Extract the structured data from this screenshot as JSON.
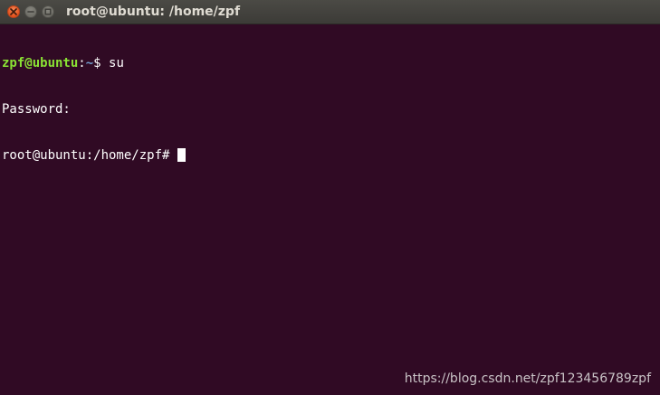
{
  "window": {
    "title": "root@ubuntu: /home/zpf",
    "buttons": {
      "close": "close-icon",
      "minimize": "minimize-icon",
      "maximize": "maximize-icon"
    }
  },
  "colors": {
    "terminal_background": "#300a24",
    "prompt_user": "#8ae234",
    "prompt_path": "#729fcf",
    "text": "#ffffff",
    "close_button": "#e2511c"
  },
  "terminal": {
    "lines": [
      {
        "user_host": "zpf@ubuntu",
        "colon": ":",
        "path": "~",
        "prompt_symbol": "$ ",
        "command": "su"
      },
      {
        "text": "Password:"
      },
      {
        "prompt": "root@ubuntu:/home/zpf# "
      }
    ]
  },
  "watermark": "https://blog.csdn.net/zpf123456789zpf"
}
